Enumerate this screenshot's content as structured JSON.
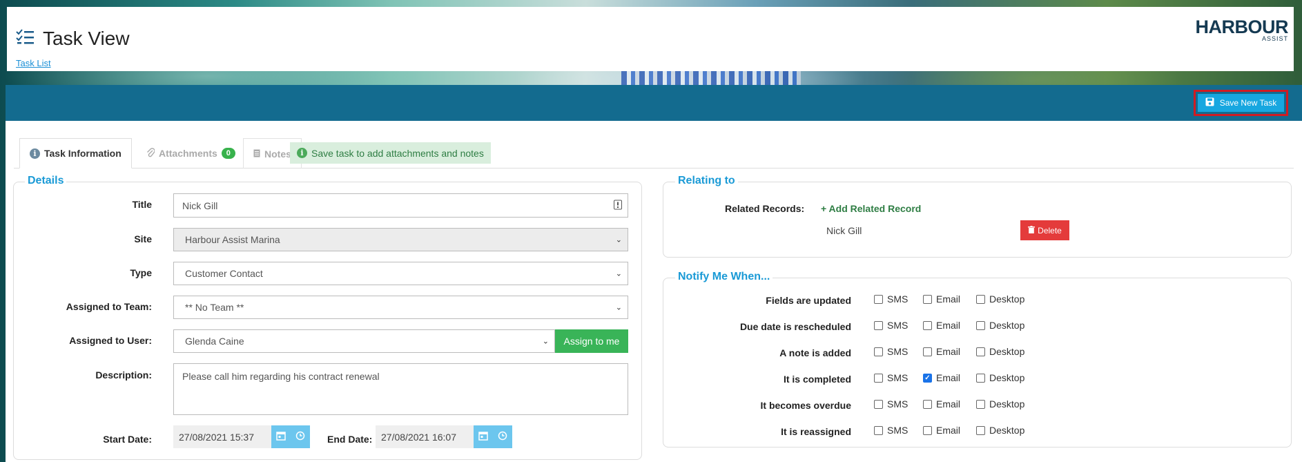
{
  "header": {
    "title": "Task View",
    "breadcrumb": "Task List",
    "logo_main": "HARBOUR",
    "logo_sub": "ASSIST"
  },
  "toolbar": {
    "save_label": "Save New Task"
  },
  "tabs": [
    {
      "label": "Task Information",
      "icon": "info-icon",
      "active": true
    },
    {
      "label": "Attachments",
      "icon": "paperclip-icon",
      "badge": "0"
    },
    {
      "label": "Notes",
      "icon": "note-icon"
    }
  ],
  "hint": "Save task to add attachments and notes",
  "details": {
    "legend": "Details",
    "title_label": "Title",
    "title_value": "Nick Gill",
    "site_label": "Site",
    "site_value": "Harbour Assist Marina",
    "type_label": "Type",
    "type_value": "Customer Contact",
    "team_label": "Assigned to Team:",
    "team_value": "** No Team **",
    "user_label": "Assigned to User:",
    "user_value": "Glenda Caine",
    "assign_label": "Assign to me",
    "desc_label": "Description:",
    "desc_value": "Please call him regarding his contract renewal",
    "start_label": "Start Date:",
    "start_value": "27/08/2021 15:37",
    "end_label": "End Date:",
    "end_value": "27/08/2021 16:07"
  },
  "relating": {
    "legend": "Relating to",
    "records_label": "Related Records:",
    "add_label": "+ Add Related Record",
    "record_name": "Nick Gill",
    "delete_label": "Delete"
  },
  "notify": {
    "legend": "Notify Me When...",
    "options": [
      "SMS",
      "Email",
      "Desktop"
    ],
    "rows": [
      {
        "label": "Fields are updated",
        "sms": false,
        "email": false,
        "desktop": false
      },
      {
        "label": "Due date is rescheduled",
        "sms": false,
        "email": false,
        "desktop": false
      },
      {
        "label": "A note is added",
        "sms": false,
        "email": false,
        "desktop": false
      },
      {
        "label": "It is completed",
        "sms": false,
        "email": true,
        "desktop": false
      },
      {
        "label": "It becomes overdue",
        "sms": false,
        "email": false,
        "desktop": false
      },
      {
        "label": "It is reassigned",
        "sms": false,
        "email": false,
        "desktop": false
      }
    ]
  },
  "colors": {
    "toolbar": "#136b8f",
    "accent": "#1a9ad6",
    "save_button": "#17a7e0",
    "save_highlight": "#d11b22",
    "assign_button": "#39b458",
    "delete_button": "#e43b3b"
  }
}
